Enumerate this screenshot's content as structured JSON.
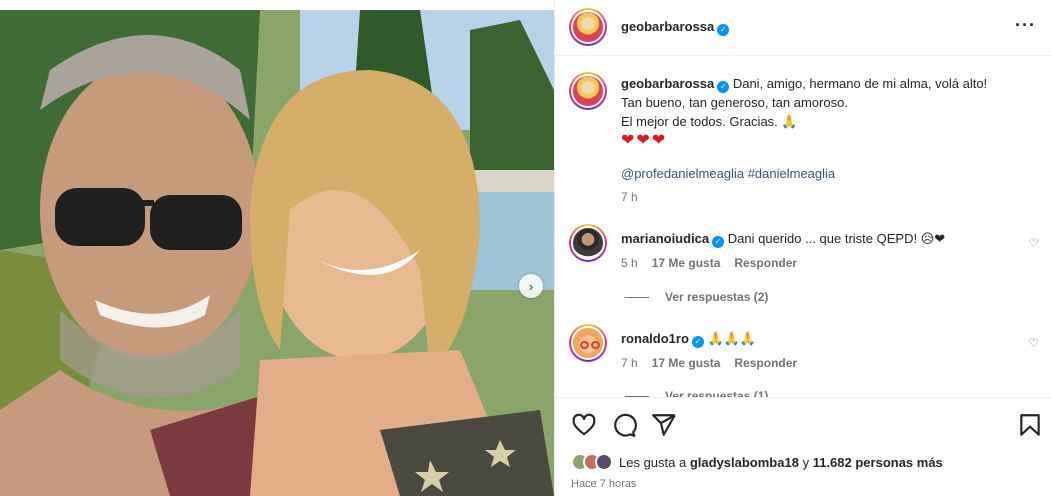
{
  "post": {
    "author": "geobarbarossa",
    "caption_lines": [
      "Dani, amigo, hermano de mi alma, volá alto!",
      "Tan bueno, tan generoso, tan amoroso.",
      "El mejor de todos. Gracias."
    ],
    "caption_emoji": "🙏",
    "hearts": "❤❤❤",
    "tags": [
      "@profedanielmeaglia",
      "#danielmeaglia"
    ],
    "caption_time": "7 h",
    "more_icon": "more-dots-icon"
  },
  "comments": [
    {
      "user": "marianoiudica",
      "text": "Dani querido ... que triste QEPD! 😥❤",
      "time": "5 h",
      "likes": "17 Me gusta",
      "reply": "Responder",
      "view_replies": "Ver respuestas (2)"
    },
    {
      "user": "ronaldo1ro",
      "text": "🙏🙏🙏",
      "time": "7 h",
      "likes": "17 Me gusta",
      "reply": "Responder",
      "view_replies": "Ver respuestas (1)"
    }
  ],
  "actions": {
    "icons": [
      "heart-icon",
      "comment-icon",
      "share-icon",
      "bookmark-icon"
    ],
    "likes_prefix": "Les gusta a",
    "likes_user": "gladyslabomba18",
    "likes_connector": "y",
    "likes_count": "11.682 personas más",
    "time_ago": "Hace 7 horas"
  },
  "colors": {
    "verified": "#0095f6",
    "link": "#00376b",
    "muted": "#737373",
    "heart": "#e0151d"
  }
}
